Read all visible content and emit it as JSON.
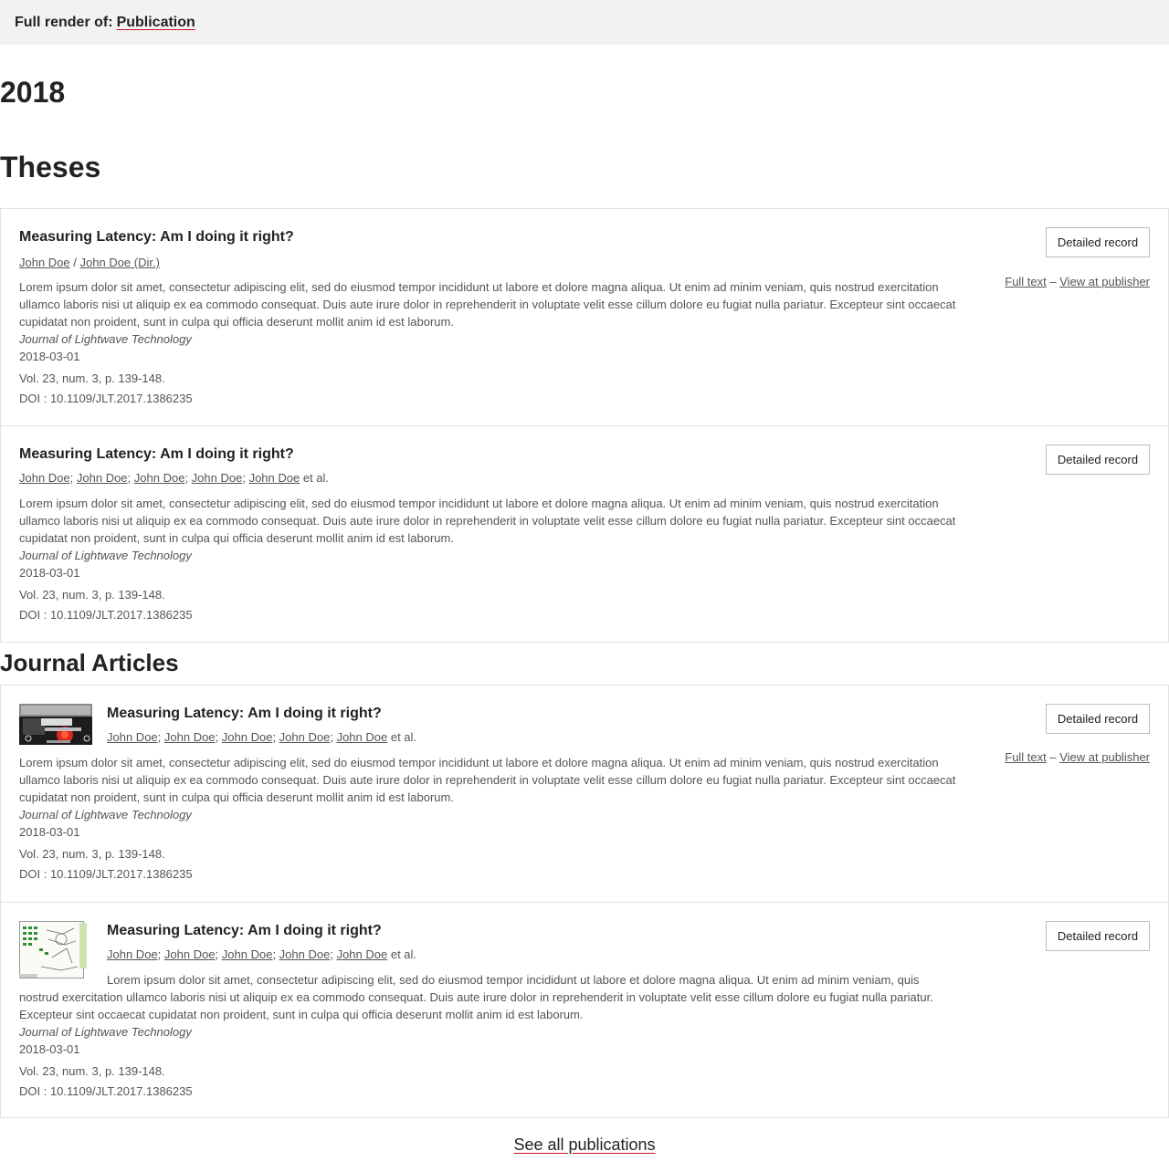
{
  "header": {
    "prefix": "Full render of:",
    "link": "Publication"
  },
  "year": "2018",
  "sections": {
    "theses": "Theses",
    "articles": "Journal Articles"
  },
  "common": {
    "title": "Measuring Latency: Am I doing it right?",
    "abstract": "Lorem ipsum dolor sit amet, consectetur adipiscing elit, sed do eiusmod tempor incididunt ut labore et dolore magna aliqua. Ut enim ad minim veniam, quis nostrud exercitation ullamco laboris nisi ut aliquip ex ea commodo consequat. Duis aute irure dolor in reprehenderit in voluptate velit esse cillum dolore eu fugiat nulla pariatur. Excepteur sint occaecat cupidatat non proident, sunt in culpa qui officia deserunt mollit anim id est laborum.",
    "journal": "Journal of Lightwave Technology",
    "date": "2018-03-01",
    "volume": "Vol. 23, num. 3, p. 139-148.",
    "doi": "DOI : 10.1109/JLT.2017.1386235",
    "detailed_record": "Detailed record",
    "full_text": "Full text",
    "link_sep": "–",
    "view_publisher": "View at publisher",
    "author": "John Doe",
    "author_dir": "John Doe (Dir.)",
    "slash": "/",
    "semicolon": ";",
    "et_al": "et al."
  },
  "footer": {
    "see_all": "See all publications"
  },
  "colors": {
    "accent": "#c8102e",
    "border": "#e3e3e3",
    "topbar": "#f2f2f3"
  }
}
